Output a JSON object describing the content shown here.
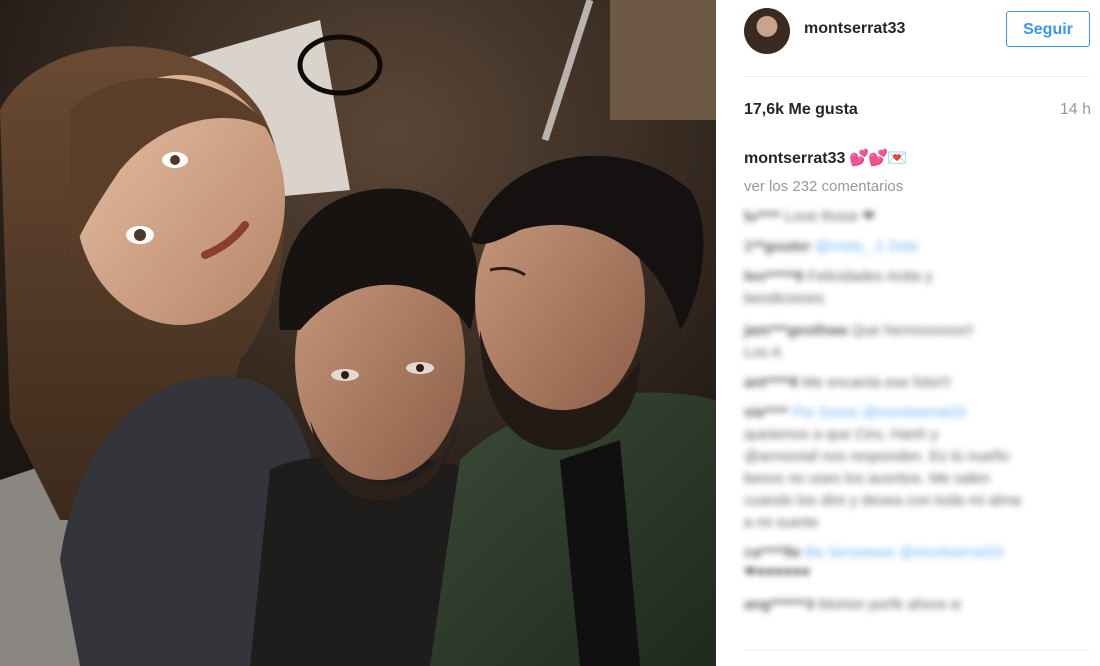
{
  "post": {
    "image_alt": "Foto de tres personas: una mujer de pelo castaño y dos hombres, uno de ellos besando la mejilla del otro",
    "username": "montserrat33",
    "follow_label": "Seguir",
    "likes": "17,6k Me gusta",
    "time_ago": "14 h",
    "caption_user": "montserrat33",
    "caption_text": "💕💕💌",
    "view_comments": "ver los 232 comentarios"
  },
  "comments": [
    {
      "user": "lu****",
      "text": "Love those ❤"
    },
    {
      "user": "1**gouter",
      "text": "@rnsts_ 2 Zeta"
    },
    {
      "user": "leo*****8",
      "text": "Felicidades Anita y"
    },
    {
      "user": "",
      "text": "bendiciones"
    },
    {
      "user": "jam***gesthwa",
      "text": "Que hermososss!!"
    },
    {
      "user": "",
      "text": "Los A"
    },
    {
      "user": "ant****8",
      "text": "Me encanta ese foto!!!"
    },
    {
      "user": "vie****",
      "text": "Pio Sssss @montserrat33"
    },
    {
      "user": "",
      "text": "queiemos a que Ciro, Hanh y"
    },
    {
      "user": "",
      "text": "@armoniaf nos responden. Es tú nueño"
    },
    {
      "user": "",
      "text": "besos no uses los acentos. Me salen"
    },
    {
      "user": "",
      "text": "cuando los dire y desea con toda mi alma"
    },
    {
      "user": "",
      "text": "a mi suerte"
    },
    {
      "user": "ca****lle",
      "text": "Ba Seceeeee @montserrat33"
    },
    {
      "user": "",
      "text": "❤♥♥♥♥♥♥"
    },
    {
      "user": "ang******3",
      "text": "Morton porfe ahora si"
    }
  ],
  "colors": {
    "accent": "#3897f0",
    "heart": "#e0245e",
    "muted": "#999999"
  }
}
